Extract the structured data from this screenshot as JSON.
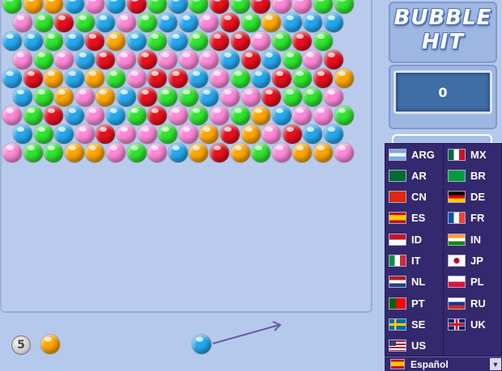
{
  "game": {
    "title_line1": "BUBBLE",
    "title_line2": "HIT",
    "score": "0",
    "remaining_shots": "5",
    "next_bubble_color": "orange",
    "current_bubble_color": "blue"
  },
  "palette": {
    "pink": "#ff88d8",
    "red": "#e8101e",
    "orange": "#ffa500",
    "green": "#2ee62e",
    "blue": "#25a8f0",
    "purple": "#5a2d95"
  },
  "bubble_rows": [
    "GOOBPBRGBGRGRPPGG",
    "PGRGBPGBBPRGOBBB",
    "BBGBROBGBGRRPGRG",
    "PGPBRPRPPPBRBGPR",
    "BROBOGPRRBPGBRGRO",
    "BGOPOBRGGBPPRGGP",
    "PGRBPBGRPGPGOBPPG",
    "BGBPRPPGPOROPRBB",
    "PGGOOPGPBOROGPOOP"
  ],
  "languages": [
    {
      "code": "ARG",
      "flag": "arg"
    },
    {
      "code": "MX",
      "flag": "mx"
    },
    {
      "code": "AR",
      "flag": "sa"
    },
    {
      "code": "BR",
      "flag": "br"
    },
    {
      "code": "CN",
      "flag": "cn"
    },
    {
      "code": "DE",
      "flag": "de"
    },
    {
      "code": "ES",
      "flag": "es"
    },
    {
      "code": "FR",
      "flag": "fr"
    },
    {
      "code": "ID",
      "flag": "id"
    },
    {
      "code": "IN",
      "flag": "in"
    },
    {
      "code": "IT",
      "flag": "it"
    },
    {
      "code": "JP",
      "flag": "jp"
    },
    {
      "code": "NL",
      "flag": "nl"
    },
    {
      "code": "PL",
      "flag": "pl"
    },
    {
      "code": "PT",
      "flag": "pt"
    },
    {
      "code": "RU",
      "flag": "ru"
    },
    {
      "code": "SE",
      "flag": "se"
    },
    {
      "code": "UK",
      "flag": "uk"
    },
    {
      "code": "US",
      "flag": "us"
    }
  ],
  "language_select": {
    "selected": "Español",
    "flag": "es",
    "arrow_icon": "chevron-down-icon"
  }
}
